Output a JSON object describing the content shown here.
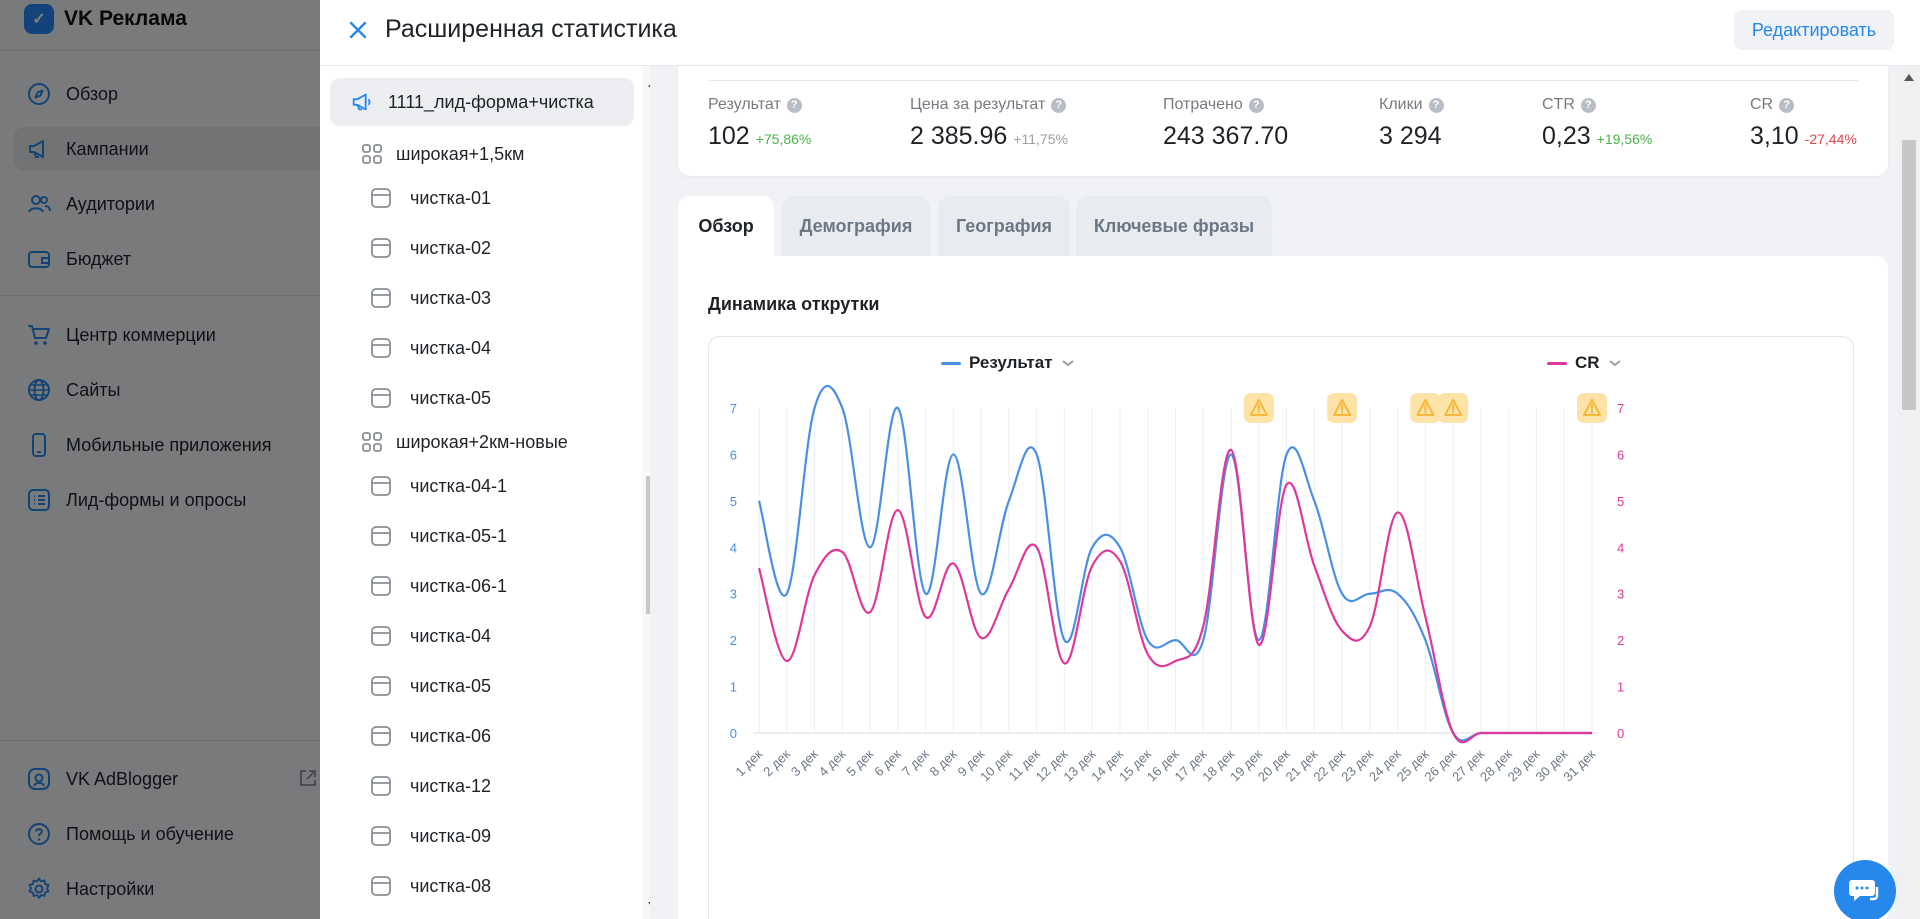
{
  "app": {
    "logo_text": "VK Реклама",
    "sidebar": [
      {
        "label": "Обзор",
        "icon": "compass-icon"
      },
      {
        "label": "Кампании",
        "icon": "megaphone-icon"
      },
      {
        "label": "Аудитории",
        "icon": "users-icon"
      },
      {
        "label": "Бюджет",
        "icon": "wallet-icon"
      },
      {
        "label": "Центр коммерции",
        "icon": "cart-icon"
      },
      {
        "label": "Сайты",
        "icon": "globe-icon"
      },
      {
        "label": "Мобильные приложения",
        "icon": "phone-icon"
      },
      {
        "label": "Лид-формы и опросы",
        "icon": "list-icon"
      }
    ],
    "sidebar_bottom": [
      {
        "label": "VK AdBlogger",
        "icon": "adblogger-icon"
      },
      {
        "label": "Помощь и обучение",
        "icon": "help-icon"
      },
      {
        "label": "Настройки",
        "icon": "gear-icon"
      }
    ]
  },
  "panel": {
    "title": "Расширенная статистика",
    "edit_label": "Редактировать",
    "tree": {
      "campaign": "1111_лид-форма+чистка",
      "groups": [
        {
          "name": "широкая+1,5км",
          "ads": [
            "чистка-01",
            "чистка-02",
            "чистка-03",
            "чистка-04",
            "чистка-05"
          ]
        },
        {
          "name": "широкая+2км-новые",
          "ads": [
            "чистка-04-1",
            "чистка-05-1",
            "чистка-06-1",
            "чистка-04",
            "чистка-05",
            "чистка-06",
            "чистка-12",
            "чистка-09",
            "чистка-08"
          ]
        }
      ]
    },
    "metrics": [
      {
        "label": "Результат",
        "value": "102",
        "delta": "+75,86%",
        "trend": "pos"
      },
      {
        "label": "Цена за результат",
        "value": "2 385.96",
        "delta": "+11,75%",
        "trend": "neutral"
      },
      {
        "label": "Потрачено",
        "value": "243 367.70",
        "delta": "",
        "trend": "none"
      },
      {
        "label": "Клики",
        "value": "3 294",
        "delta": "",
        "trend": "none"
      },
      {
        "label": "CTR",
        "value": "0,23",
        "delta": "+19,56%",
        "trend": "pos"
      },
      {
        "label": "CR",
        "value": "3,10",
        "delta": "-27,44%",
        "trend": "neg"
      }
    ],
    "tabs": [
      "Обзор",
      "Демография",
      "География",
      "Ключевые фразы"
    ],
    "active_tab": "Обзор",
    "chart_title": "Динамика открутки"
  },
  "chart_data": {
    "type": "line",
    "title": "",
    "x": [
      "1 дек",
      "2 дек",
      "3 дек",
      "4 дек",
      "5 дек",
      "6 дек",
      "7 дек",
      "8 дек",
      "9 дек",
      "10 дек",
      "11 дек",
      "12 дек",
      "13 дек",
      "14 дек",
      "15 дек",
      "16 дек",
      "17 дек",
      "18 дек",
      "19 дек",
      "20 дек",
      "21 дек",
      "22 дек",
      "23 дек",
      "24 дек",
      "25 дек",
      "26 дек",
      "27 дек",
      "28 дек",
      "29 дек",
      "30 дек",
      "31 дек"
    ],
    "series": [
      {
        "name": "Результат",
        "color": "#4a90e2",
        "axis": "left",
        "values": [
          5,
          3,
          7,
          7,
          4,
          7,
          3,
          6,
          3,
          5,
          6,
          2,
          4,
          4,
          2,
          2,
          2,
          6,
          2,
          6,
          5,
          3,
          3,
          3,
          2,
          0,
          0,
          0,
          0,
          0,
          0
        ]
      },
      {
        "name": "CR",
        "color": "#e0389a",
        "axis": "right",
        "values": [
          3.55,
          1.55,
          3.4,
          3.9,
          2.6,
          4.8,
          2.5,
          3.65,
          2.05,
          3.1,
          4.0,
          1.5,
          3.6,
          3.7,
          1.7,
          1.55,
          2.3,
          6.1,
          1.9,
          5.35,
          3.6,
          2.2,
          2.3,
          4.75,
          2.5,
          0,
          0,
          0,
          0,
          0,
          0
        ]
      }
    ],
    "y_left": {
      "ticks": [
        0,
        1,
        2,
        3,
        4,
        5,
        6,
        7
      ],
      "ylim": [
        0,
        7
      ],
      "color": "#4a90e2"
    },
    "y_right": {
      "ticks": [
        0,
        1,
        2,
        3,
        4,
        5,
        6,
        7
      ],
      "ylim": [
        0,
        7
      ],
      "color": "#e0389a"
    },
    "warnings_at": [
      "19 дек",
      "22 дек",
      "25 дек",
      "26 дек",
      "31 дек"
    ],
    "warning_color": "#f5b83d",
    "grid": "vertical"
  }
}
